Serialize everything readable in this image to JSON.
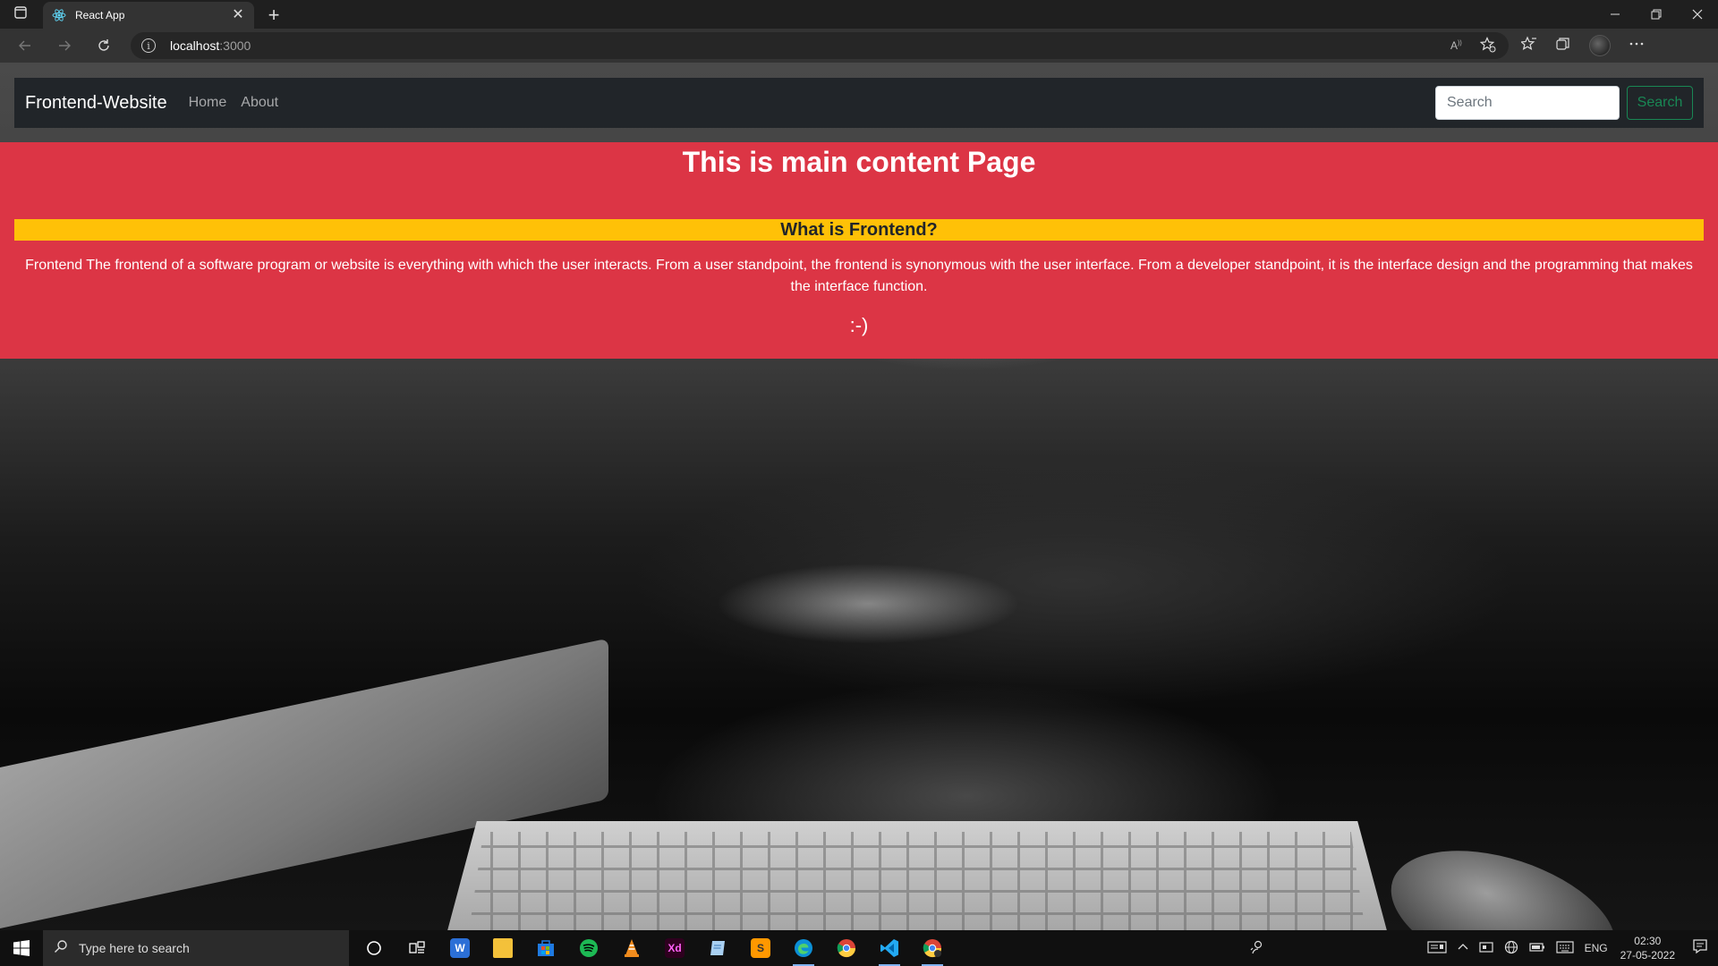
{
  "browser": {
    "tab_title": "React App",
    "url_host": "localhost",
    "url_port": ":3000",
    "new_tab_symbol": "+",
    "tab_close_symbol": "✕"
  },
  "site": {
    "brand": "Frontend-Website",
    "nav": [
      "Home",
      "About"
    ],
    "search_placeholder": "Search",
    "search_button": "Search",
    "heading": "This is main content Page",
    "subheading": "What is Frontend?",
    "description": "Frontend The frontend of a software program or website is everything with which the user interacts. From a user standpoint, the frontend is synonymous with the user interface. From a developer standpoint, it is the interface design and the programming that makes the interface function.",
    "smiley": ":-)"
  },
  "colors": {
    "navbar": "#212529",
    "content_bg": "#dc3545",
    "subheading_bg": "#ffc107",
    "search_button": "#198754"
  },
  "taskbar": {
    "search_placeholder": "Type here to search",
    "language": "ENG",
    "time": "02:30",
    "date": "27-05-2022",
    "apps": [
      "cortana-icon",
      "task-view-icon",
      "wps-icon",
      "file-explorer-icon",
      "store-icon",
      "spotify-icon",
      "vlc-icon",
      "adobe-xd-icon",
      "notepad-icon",
      "sublime-icon",
      "edge-icon",
      "chrome-icon",
      "vscode-icon",
      "chrome-alt-icon"
    ]
  }
}
